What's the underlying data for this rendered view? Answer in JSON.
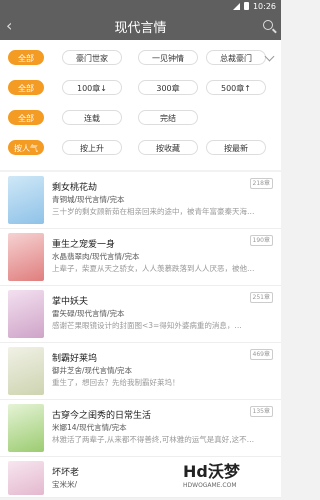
{
  "status_bar": {
    "time": "10:26"
  },
  "app_bar": {
    "title": "现代言情"
  },
  "filters": {
    "rows": [
      {
        "label": "全部",
        "options": [
          "豪门世家",
          "一见钟情",
          "总裁豪门"
        ]
      },
      {
        "label": "全部",
        "options": [
          "100章↓",
          "300章",
          "500章↑"
        ]
      },
      {
        "label": "全部",
        "options": [
          "连载",
          "完结"
        ]
      },
      {
        "label": "按人气",
        "options": [
          "按上升",
          "按收藏",
          "按最新"
        ]
      }
    ]
  },
  "books": [
    {
      "title": "剩女桃花劫",
      "meta": "青铜城/现代言情/完本",
      "desc": "三十岁的剩女顾新茹在相亲回来的途中，被青年富豪秦天海…",
      "badge": "218章"
    },
    {
      "title": "重生之宠爱一身",
      "meta": "水晶翡翠肉/现代言情/完本",
      "desc": "上辈子，柴夏从天之骄女，人人羡慕跌落到人人厌恶，被他…",
      "badge": "190章"
    },
    {
      "title": "掌中妖夫",
      "meta": "雷矢碌/现代言情/完本",
      "desc": "感谢芒果眼镜设计的封面图<3=得知外婆病重的消息，…",
      "badge": "251章"
    },
    {
      "title": "制霸好莱坞",
      "meta": "御井芝舍/现代言情/完本",
      "desc": "重生了，想回去？先给我制霸好莱坞！",
      "badge": "469章"
    },
    {
      "title": "古穿今之闺秀的日常生活",
      "meta": "米娜14/现代言情/完本",
      "desc": "林雅活了两辈子,从来都不得善终,可林雅的运气是真好,这不…",
      "badge": "135章"
    },
    {
      "title": "坏坏老",
      "meta": "宝米米/",
      "desc": "",
      "badge": ""
    }
  ],
  "watermark": {
    "logo": "Hd沃梦",
    "site": "HDWOGAME.COM"
  }
}
